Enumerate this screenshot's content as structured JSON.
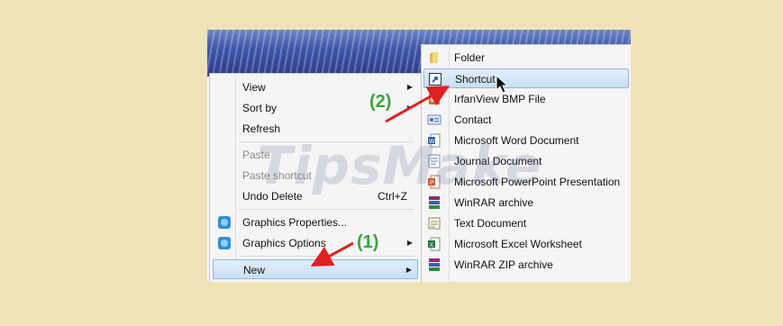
{
  "context_menu": {
    "items": [
      {
        "label": "View",
        "submenu": true
      },
      {
        "label": "Sort by",
        "submenu": true
      },
      {
        "label": "Refresh"
      },
      {
        "label": "Paste",
        "disabled": true
      },
      {
        "label": "Paste shortcut",
        "disabled": true
      },
      {
        "label": "Undo Delete",
        "accel": "Ctrl+Z"
      },
      {
        "label": "Graphics Properties...",
        "icon": "graphics-icon"
      },
      {
        "label": "Graphics Options",
        "icon": "graphics-icon",
        "submenu": true
      },
      {
        "label": "New",
        "submenu": true,
        "highlighted": true
      }
    ]
  },
  "new_submenu": {
    "items": [
      {
        "label": "Folder",
        "icon": "folder-icon"
      },
      {
        "label": "Shortcut",
        "icon": "shortcut-icon",
        "highlighted": true
      },
      {
        "label": "IrfanView BMP File",
        "icon": "bmp-file-icon"
      },
      {
        "label": "Contact",
        "icon": "contact-icon"
      },
      {
        "label": "Microsoft Word Document",
        "icon": "word-document-icon"
      },
      {
        "label": "Journal Document",
        "icon": "journal-document-icon"
      },
      {
        "label": "Microsoft PowerPoint Presentation",
        "icon": "powerpoint-icon"
      },
      {
        "label": "WinRAR archive",
        "icon": "winrar-icon"
      },
      {
        "label": "Text Document",
        "icon": "text-document-icon"
      },
      {
        "label": "Microsoft Excel Worksheet",
        "icon": "excel-icon"
      },
      {
        "label": "WinRAR ZIP archive",
        "icon": "winrar-zip-icon"
      }
    ]
  },
  "annotations": {
    "step1": "(1)",
    "step2": "(2)",
    "arrow_color": "#e02020",
    "step_color": "#39a63a"
  },
  "watermark": "TipsMake"
}
